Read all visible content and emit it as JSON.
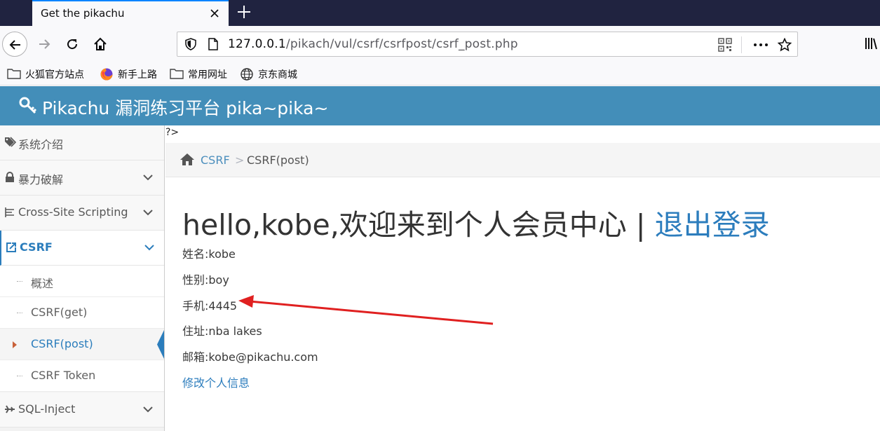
{
  "browser": {
    "tab_title": "Get the pikachu",
    "url_host": "127.0.0.1",
    "url_path": "/pikach/vul/csrf/csrfpost/csrf_post.php",
    "bookmarks": [
      "火狐官方站点",
      "新手上路",
      "常用网址",
      "京东商城"
    ]
  },
  "site": {
    "title": "Pikachu 漏洞练习平台 pika~pika~",
    "header_color": "#438eb9"
  },
  "sidebar": {
    "items": [
      {
        "label": "系统介绍",
        "icon": "tags-icon"
      },
      {
        "label": "暴力破解",
        "icon": "lock-icon"
      },
      {
        "label": "Cross-Site Scripting",
        "icon": "list-icon"
      },
      {
        "label": "CSRF",
        "icon": "share-square-icon"
      },
      {
        "label": "SQL-Inject",
        "icon": "plane-icon"
      }
    ],
    "csrf_sub": [
      "概述",
      "CSRF(get)",
      "CSRF(post)",
      "CSRF Token"
    ],
    "current_sub": "CSRF(post)"
  },
  "main": {
    "stray_text": "?>",
    "breadcrumb": {
      "link": "CSRF",
      "separator": ">",
      "current": "CSRF(post)"
    },
    "heading": "hello,kobe,欢迎来到个人会员中心 | ",
    "logout": "退出登录",
    "info": {
      "name": "姓名:kobe",
      "sex": "性别:boy",
      "phone": "手机:4445",
      "address": "住址:nba lakes",
      "email": "邮箱:kobe@pikachu.com"
    },
    "edit_link": "修改个人信息"
  },
  "colors": {
    "accent": "#2c7dbd",
    "annotation_arrow": "#e02020"
  }
}
